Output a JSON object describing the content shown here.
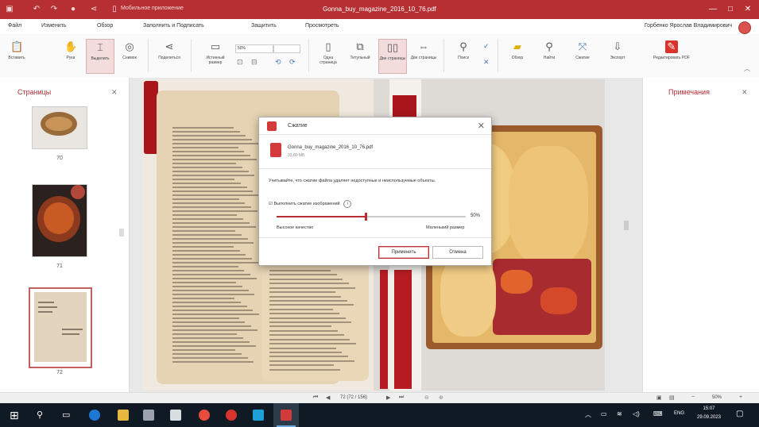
{
  "titlebar": {
    "title": "Gonna_buy_magazine_2016_10_76.pdf",
    "mobile_label": "Мобильное приложение",
    "win_buttons": [
      "—",
      "□",
      "✕"
    ]
  },
  "menubar": {
    "items": [
      "Файл",
      "Изменить",
      "Обзор",
      "Заполнить и Подписать",
      "Защитить",
      "Просмотреть"
    ],
    "user_name": "Горбенко Ярослав Владимирович"
  },
  "ribbon": {
    "items": [
      {
        "label": "Вставить",
        "icon": "paste-icon"
      },
      {
        "label": "Рука",
        "icon": "hand-icon"
      },
      {
        "label": "Выделить",
        "icon": "select-icon"
      },
      {
        "label": "Снимок",
        "icon": "snapshot-icon"
      },
      {
        "label": "Поделиться",
        "icon": "share-icon"
      },
      {
        "label": "Истинный размер",
        "icon": "actual-size-icon"
      },
      {
        "label": "Одна страница",
        "icon": "single-page-icon"
      },
      {
        "label": "Титульный",
        "icon": "cover-icon"
      },
      {
        "label": "Две страницы",
        "icon": "two-page-icon"
      },
      {
        "label": "Две страницы",
        "icon": "two-page-scroll-icon"
      },
      {
        "label": "Поиск",
        "icon": "search-doc-icon"
      },
      {
        "label": "Обзор",
        "icon": "review-icon"
      },
      {
        "label": "Найти",
        "icon": "find-icon"
      },
      {
        "label": "Сжатие",
        "icon": "compress-icon"
      },
      {
        "label": "Экспорт",
        "icon": "export-icon"
      },
      {
        "label": "Редактировать PDF",
        "icon": "edit-pdf-icon"
      }
    ],
    "zoom_value": "50%"
  },
  "left_panel": {
    "title": "Страницы",
    "thumbs": [
      {
        "num": "70"
      },
      {
        "num": "71"
      },
      {
        "num": "72"
      }
    ]
  },
  "right_panel": {
    "title": "Примечания"
  },
  "status": {
    "page_info": "72 (72 / 156)",
    "zoom": "50%"
  },
  "dialog": {
    "title": "Сжатие",
    "file_name": "Gonna_buy_magazine_2016_10_76.pdf",
    "file_size": "33,80 МБ",
    "description": "Учитывайте, что сжатие файла удаляет недоступные и неиспользуемые объекты.",
    "check_label": "Выполнить сжатие изображений",
    "slider_value": "50%",
    "slider_fraction": 0.47,
    "left_label": "Высокое качество",
    "right_label": "Маленький размер",
    "apply_label": "Применить",
    "cancel_label": "Отмена"
  },
  "taskbar": {
    "lang": "ENG",
    "time": "15:07",
    "date": "29.09.2023"
  },
  "colors": {
    "accent": "#b52f33",
    "taskbar": "#101a24"
  }
}
